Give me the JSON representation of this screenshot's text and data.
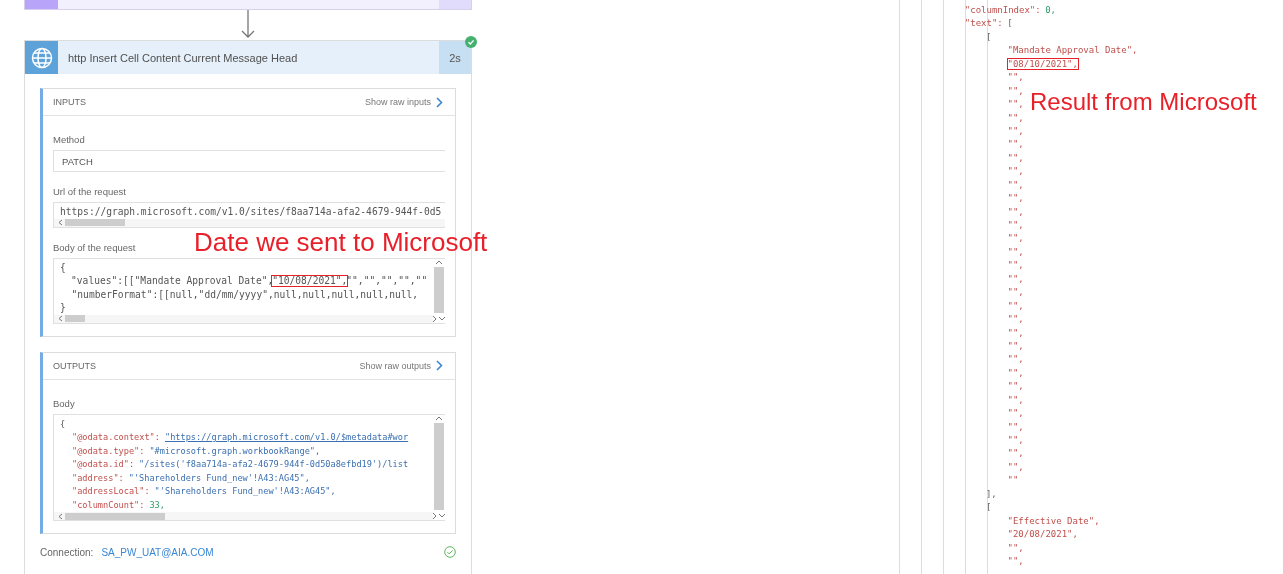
{
  "step": {
    "title": "http Insert Cell Content Current Message Head",
    "duration": "2s",
    "succeeded": true
  },
  "inputs": {
    "heading": "INPUTS",
    "raw_link": "Show raw inputs",
    "fields": [
      {
        "label": "Method",
        "kind": "text",
        "value": "PATCH"
      },
      {
        "label": "Url of the request",
        "kind": "code",
        "lines": [
          "https://graph.microsoft.com/v1.0/sites/f8aa714a-afa2-4679-944f-0d5"
        ]
      },
      {
        "label": "Body of the request",
        "kind": "code",
        "lines": [
          "{",
          {
            "parts": [
              {
                "text": "  \"values\":[[\"Mandate Approval Date\",",
                "highlighted": false
              },
              {
                "text": "\"10/08/2021\",",
                "highlighted": true
              },
              {
                "text": "\"\",\"\",\"\",\"\",\"\"",
                "highlighted": false
              }
            ]
          },
          "  \"numberFormat\":[[null,\"dd/mm/yyyy\",null,null,null,null,null,",
          "}"
        ]
      }
    ]
  },
  "outputs": {
    "heading": "OUTPUTS",
    "raw_link": "Show raw outputs",
    "body_label": "Body",
    "body": [
      {
        "value": "{",
        "kind": "punct"
      },
      {
        "key": "\"@odata.context\":",
        "value": "\"https://graph.microsoft.com/v1.0/$metadata#wor",
        "kind": "link"
      },
      {
        "key": "\"@odata.type\":",
        "value": "\"#microsoft.graph.workbookRange\",",
        "kind": "string"
      },
      {
        "key": "\"@odata.id\":",
        "value": "\"/sites('f8aa714a-afa2-4679-944f-0d50a8efbd19')/list",
        "kind": "string"
      },
      {
        "key": "\"address\":",
        "value": "\"'Shareholders Fund_new'!A43:AG45\",",
        "kind": "string"
      },
      {
        "key": "\"addressLocal\":",
        "value": "\"'Shareholders Fund_new'!A43:AG45\",",
        "kind": "string"
      },
      {
        "key": "\"columnCount\":",
        "value": "33,",
        "kind": "number"
      }
    ]
  },
  "connection": {
    "label": "Connection:",
    "account": "SA_PW_UAT@AIA.COM",
    "ok": true
  },
  "result_code": [
    {
      "key": "\"columnIndex\":",
      "value": "0,",
      "kind": "number"
    },
    {
      "key": "\"text\":",
      "value": "[",
      "kind": "punct",
      "children": [
        {
          "value": "[",
          "kind": "punct",
          "children": [
            {
              "value": "\"Mandate Approval Date\",",
              "kind": "string"
            },
            {
              "value": "\"08/10/2021\",",
              "kind": "string",
              "highlighted": true
            },
            {
              "value": "\"\",",
              "kind": "string"
            },
            {
              "value": "\"\",",
              "kind": "string"
            },
            {
              "value": "\"\",",
              "kind": "string"
            },
            {
              "value": "\"\",",
              "kind": "string"
            },
            {
              "value": "\"\",",
              "kind": "string"
            },
            {
              "value": "\"\",",
              "kind": "string"
            },
            {
              "value": "\"\",",
              "kind": "string"
            },
            {
              "value": "\"\",",
              "kind": "string"
            },
            {
              "value": "\"\",",
              "kind": "string"
            },
            {
              "value": "\"\",",
              "kind": "string"
            },
            {
              "value": "\"\",",
              "kind": "string"
            },
            {
              "value": "\"\",",
              "kind": "string"
            },
            {
              "value": "\"\",",
              "kind": "string"
            },
            {
              "value": "\"\",",
              "kind": "string"
            },
            {
              "value": "\"\",",
              "kind": "string"
            },
            {
              "value": "\"\",",
              "kind": "string"
            },
            {
              "value": "\"\",",
              "kind": "string"
            },
            {
              "value": "\"\",",
              "kind": "string"
            },
            {
              "value": "\"\",",
              "kind": "string"
            },
            {
              "value": "\"\",",
              "kind": "string"
            },
            {
              "value": "\"\",",
              "kind": "string"
            },
            {
              "value": "\"\",",
              "kind": "string"
            },
            {
              "value": "\"\",",
              "kind": "string"
            },
            {
              "value": "\"\",",
              "kind": "string"
            },
            {
              "value": "\"\",",
              "kind": "string"
            },
            {
              "value": "\"\",",
              "kind": "string"
            },
            {
              "value": "\"\",",
              "kind": "string"
            },
            {
              "value": "\"\",",
              "kind": "string"
            },
            {
              "value": "\"\",",
              "kind": "string"
            },
            {
              "value": "\"\",",
              "kind": "string"
            },
            {
              "value": "\"\"",
              "kind": "string"
            }
          ]
        },
        {
          "value": "],",
          "kind": "punct"
        },
        {
          "value": "[",
          "kind": "punct",
          "children": [
            {
              "value": "\"Effective Date\",",
              "kind": "string"
            },
            {
              "value": "\"20/08/2021\",",
              "kind": "string"
            },
            {
              "value": "\"\",",
              "kind": "string"
            },
            {
              "value": "\"\",",
              "kind": "string"
            }
          ]
        }
      ]
    }
  ],
  "annotations": [
    {
      "text": "Date we sent to Microsoft"
    },
    {
      "text": "Result from Microsoft"
    }
  ]
}
